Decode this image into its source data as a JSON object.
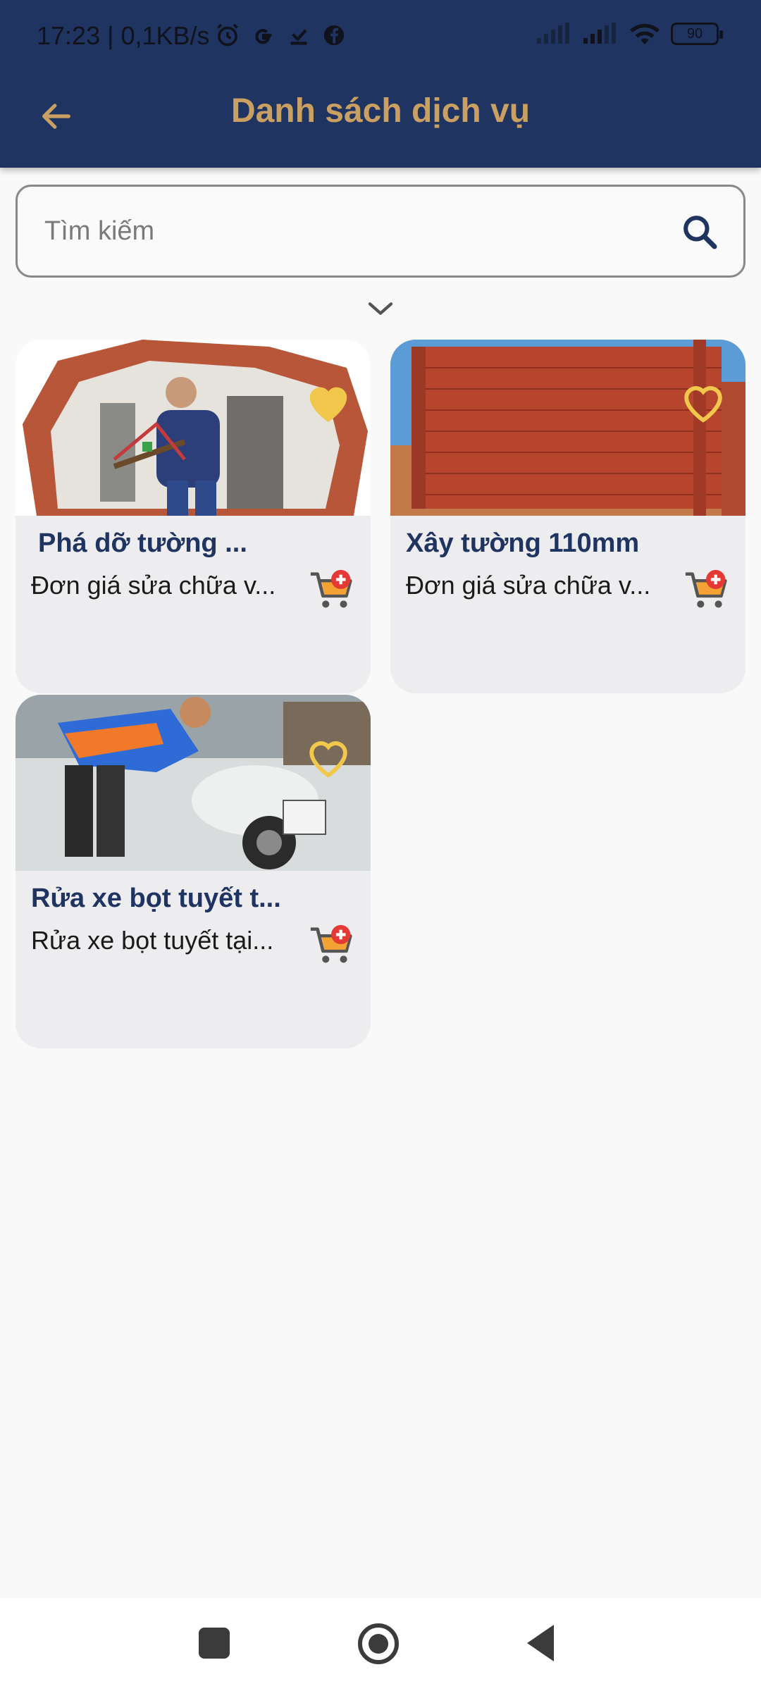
{
  "status_bar": {
    "time": "17:23 | 0,1KB/s",
    "battery": "90"
  },
  "header": {
    "title": "Danh sách dịch vụ"
  },
  "search": {
    "placeholder": "Tìm kiếm"
  },
  "services": [
    {
      "title": "Phá dỡ tường ...",
      "description": "Đơn giá sửa chữa v...",
      "favorited": true
    },
    {
      "title": "Xây tường 110mm",
      "description": "Đơn giá sửa chữa v...",
      "favorited": false
    },
    {
      "title": "Rửa xe bọt tuyết t...",
      "description": "Rửa xe bọt tuyết tại...",
      "favorited": false
    }
  ],
  "colors": {
    "appbar": "#1f3460",
    "accent_gold": "#c9a062",
    "heart": "#f1c84b",
    "card_bg": "#ededef",
    "cart_orange": "#f3a233",
    "cart_red": "#e53935"
  }
}
